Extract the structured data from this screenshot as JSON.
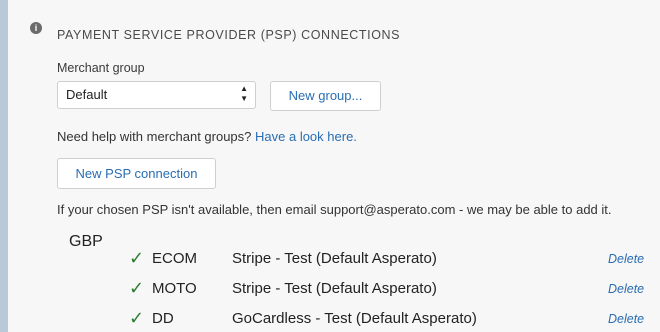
{
  "section": {
    "title": "PAYMENT SERVICE PROVIDER (PSP) CONNECTIONS",
    "info_icon": "info-icon"
  },
  "merchant_group": {
    "label": "Merchant group",
    "selected": "Default",
    "new_group_label": "New group..."
  },
  "help": {
    "text": "Need help with merchant groups?",
    "link": "Have a look here."
  },
  "new_psp_label": "New PSP connection",
  "note": "If your chosen PSP isn't available, then email support@asperato.com - we may be able to add it.",
  "currency": "GBP",
  "connections": [
    {
      "type": "ECOM",
      "provider": "Stripe - Test (Default Asperato)",
      "action": "Delete"
    },
    {
      "type": "MOTO",
      "provider": "Stripe - Test (Default Asperato)",
      "action": "Delete"
    },
    {
      "type": "DD",
      "provider": "GoCardless - Test (Default Asperato)",
      "action": "Delete"
    }
  ],
  "colors": {
    "link": "#2a6db3",
    "check": "#2e7d32"
  }
}
